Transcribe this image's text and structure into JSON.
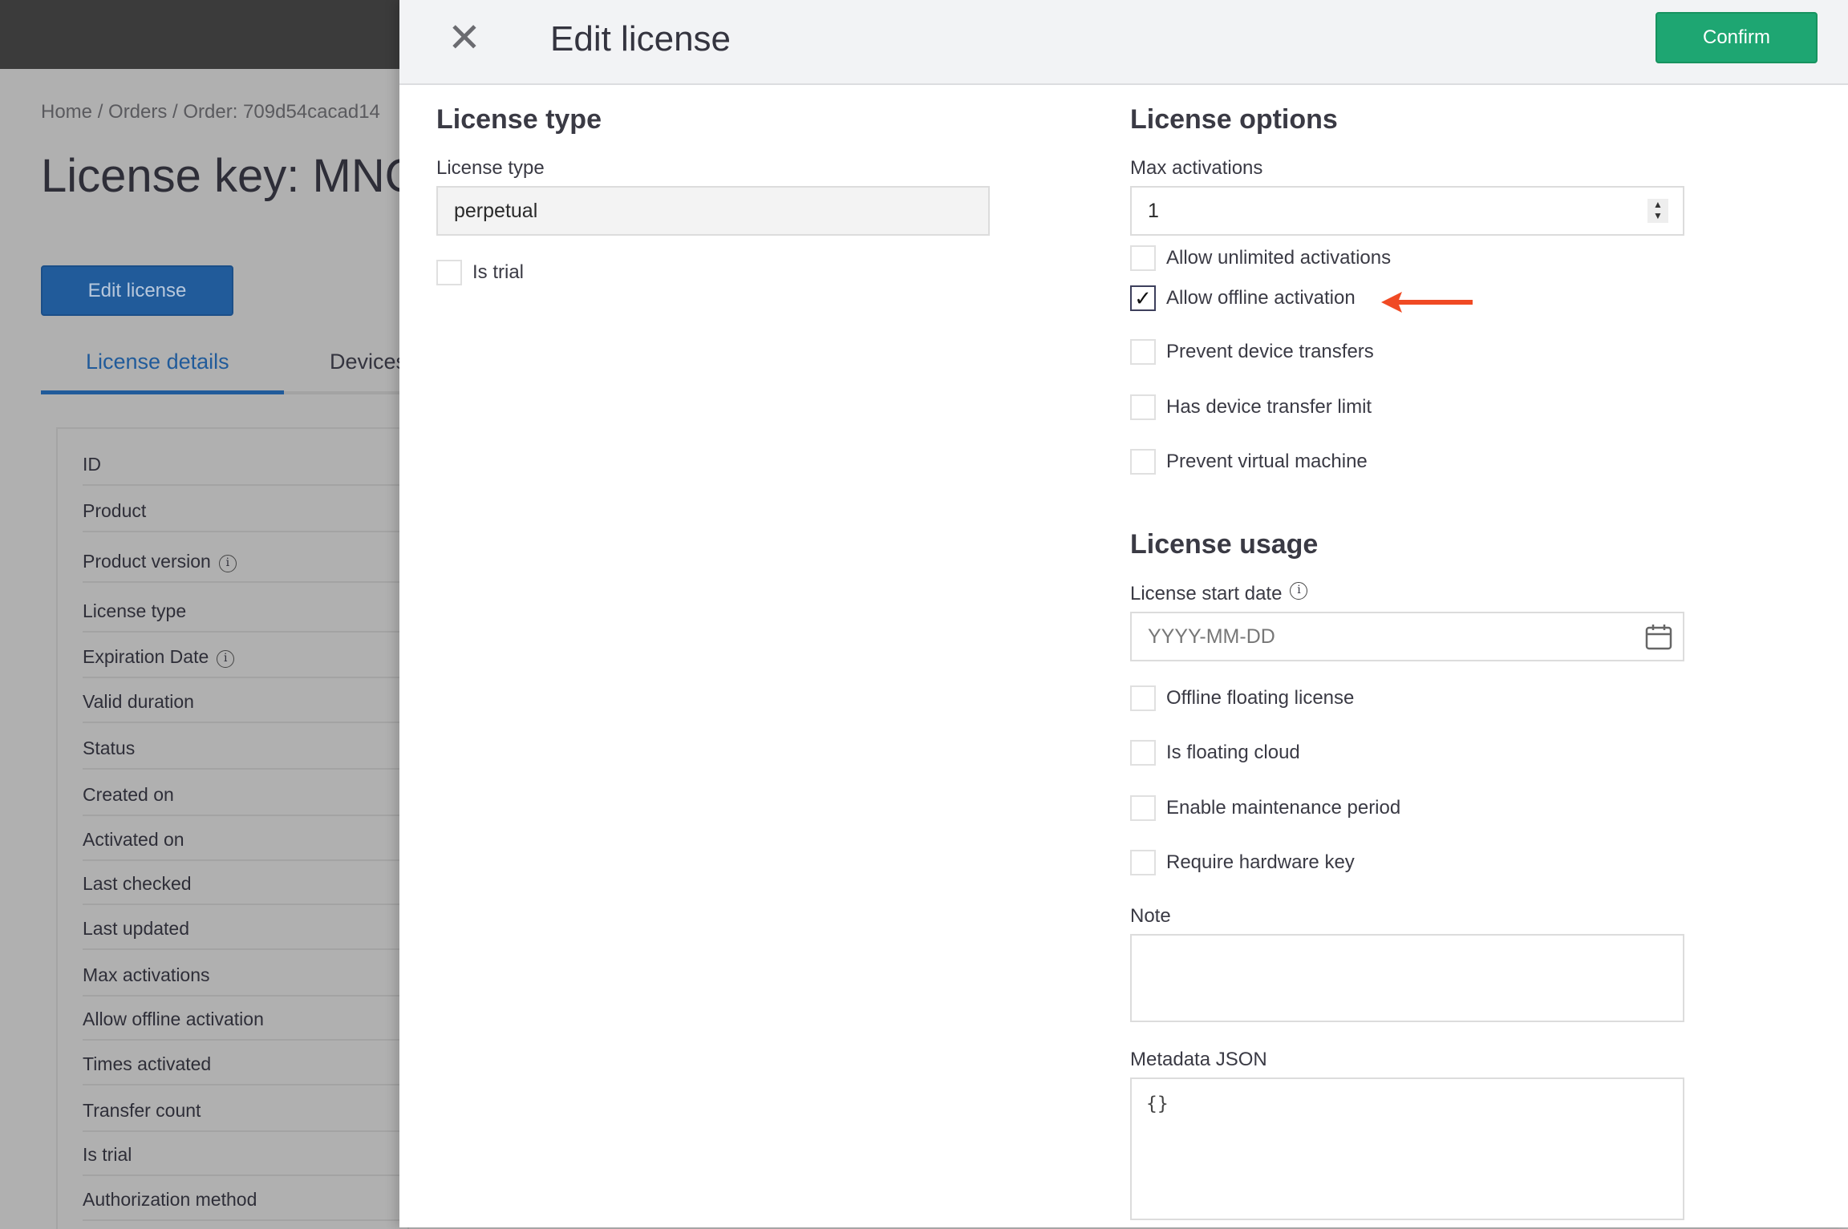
{
  "background": {
    "breadcrumb": "Home / Orders / Order: 709d54cacad14",
    "title": "License key: MNQ",
    "edit_button": "Edit license",
    "tabs": [
      "License details",
      "Devices"
    ],
    "detail_rows": [
      "ID",
      "Product",
      "Product version",
      "License type",
      "Expiration Date",
      "Valid duration",
      "Status",
      "Created on",
      "Activated on",
      "Last checked",
      "Last updated",
      "Max activations",
      "Allow offline activation",
      "Times activated",
      "Transfer count",
      "Is trial",
      "Authorization method"
    ]
  },
  "drawer": {
    "title": "Edit license",
    "confirm": "Confirm",
    "license_type_section": {
      "heading": "License type",
      "field_label": "License type",
      "field_value": "perpetual",
      "is_trial_label": "Is trial",
      "is_trial": false
    },
    "license_options": {
      "heading": "License options",
      "max_activations_label": "Max activations",
      "max_activations": "1",
      "checkboxes": [
        {
          "label": "Allow unlimited activations",
          "checked": false
        },
        {
          "label": "Allow offline activation",
          "checked": true
        },
        {
          "label": "Prevent device transfers",
          "checked": false
        },
        {
          "label": "Has device transfer limit",
          "checked": false
        },
        {
          "label": "Prevent virtual machine",
          "checked": false
        }
      ]
    },
    "license_usage": {
      "heading": "License usage",
      "start_date_label": "License start date",
      "start_date_placeholder": "YYYY-MM-DD",
      "checkboxes": [
        {
          "label": "Offline floating license",
          "checked": false
        },
        {
          "label": "Is floating cloud",
          "checked": false
        },
        {
          "label": "Enable maintenance period",
          "checked": false
        },
        {
          "label": "Require hardware key",
          "checked": false
        }
      ],
      "note_label": "Note",
      "note_value": "",
      "metadata_label": "Metadata JSON",
      "metadata_value": "{}"
    },
    "annotation_color": "#f04a24"
  }
}
